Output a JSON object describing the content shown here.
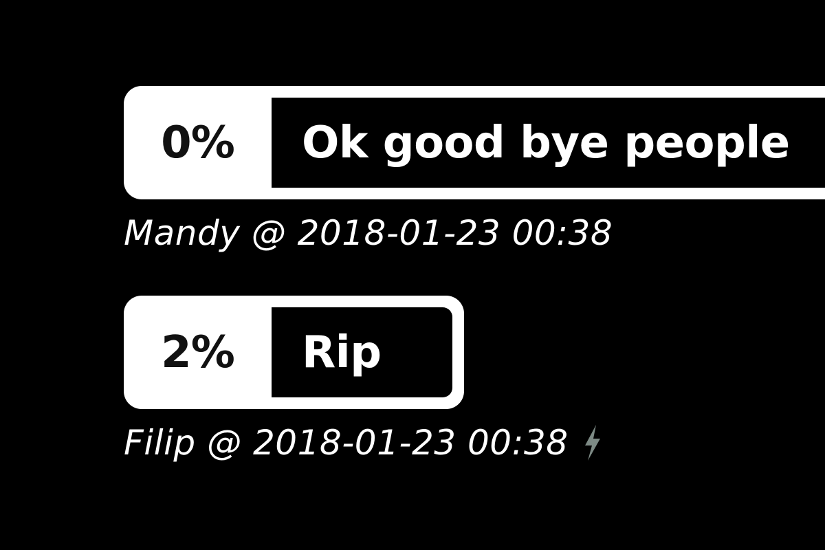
{
  "messages": [
    {
      "percent": "0%",
      "text": "Ok good bye people",
      "author": "Mandy",
      "separator": "@",
      "timestamp": "2018-01-23 00:38",
      "icon": null
    },
    {
      "percent": "2%",
      "text": "Rip",
      "author": "Filip",
      "separator": "@",
      "timestamp": "2018-01-23 00:38",
      "icon": "lightning-bolt-icon"
    }
  ],
  "colors": {
    "background": "#000000",
    "bubble": "#ffffff",
    "text_light": "#ffffff",
    "text_dark": "#111111",
    "icon_gray": "#7d8a85"
  }
}
